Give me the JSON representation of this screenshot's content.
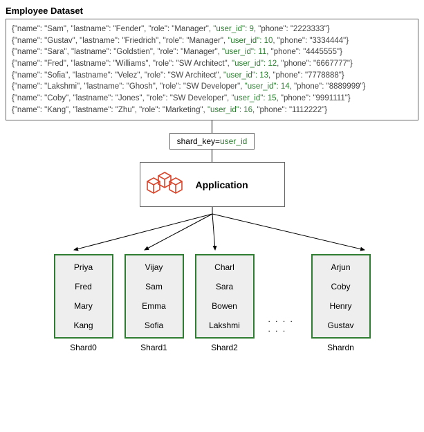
{
  "title": "Employee Dataset",
  "records": [
    {
      "name": "Sam",
      "lastname": "Fender",
      "role": "Manager",
      "user_id": 9,
      "phone": "2223333"
    },
    {
      "name": "Gustav",
      "lastname": "Friedrich",
      "role": "Manager",
      "user_id": 10,
      "phone": "3334444"
    },
    {
      "name": "Sara",
      "lastname": "Goldstien",
      "role": "Manager",
      "user_id": 11,
      "phone": "4445555"
    },
    {
      "name": "Fred",
      "lastname": "Williams",
      "role": "SW Architect",
      "user_id": 12,
      "phone": "6667777"
    },
    {
      "name": "Sofia",
      "lastname": "Velez",
      "role": "SW Architect",
      "user_id": 13,
      "phone": "7778888"
    },
    {
      "name": "Lakshmi",
      "lastname": "Ghosh",
      "role": "SW Developer",
      "user_id": 14,
      "phone": "8889999"
    },
    {
      "name": "Coby",
      "lastname": "Jones",
      "role": "SW Developer",
      "user_id": 15,
      "phone": "9991111"
    },
    {
      "name": "Kang",
      "lastname": "Zhu",
      "role": "Marketing",
      "user_id": 16,
      "phone": "1112222"
    }
  ],
  "shard_key_label": "shard_key=",
  "shard_key_value": "user_id",
  "application_label": "Application",
  "ellipsis": ". . . . . . .",
  "shards": [
    {
      "label": "Shard0",
      "items": [
        "Priya",
        "Fred",
        "Mary",
        "Kang"
      ]
    },
    {
      "label": "Shard1",
      "items": [
        "Vijay",
        "Sam",
        "Emma",
        "Sofia"
      ]
    },
    {
      "label": "Shard2",
      "items": [
        "Charl",
        "Sara",
        "Bowen",
        "Lakshmi"
      ]
    },
    {
      "label": "Shardn",
      "items": [
        "Arjun",
        "Coby",
        "Henry",
        "Gustav"
      ]
    }
  ]
}
